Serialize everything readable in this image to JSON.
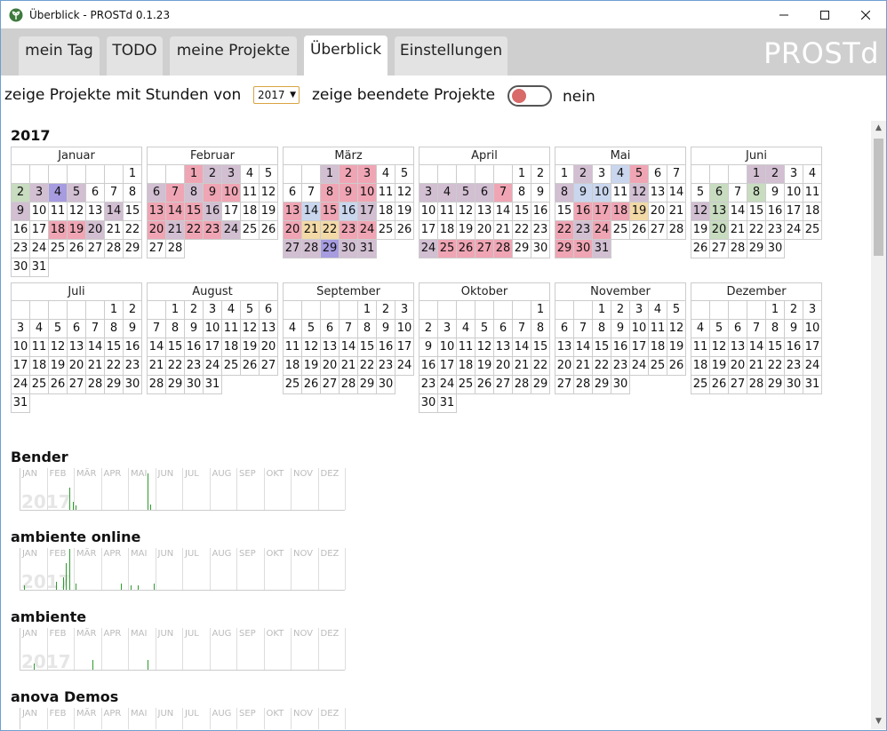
{
  "window": {
    "title": "Überblick - PROSTd 0.1.23",
    "minimize_icon": "minimize-icon",
    "maximize_icon": "maximize-icon",
    "close_icon": "close-icon"
  },
  "tabs": [
    {
      "label": "mein Tag",
      "active": false
    },
    {
      "label": "TODO",
      "active": false
    },
    {
      "label": "meine Projekte",
      "active": false
    },
    {
      "label": "Überblick",
      "active": true
    },
    {
      "label": "Einstellungen",
      "active": false
    }
  ],
  "brand": "PROSTd",
  "filter": {
    "label_hours": "zeige Projekte mit Stunden von",
    "year_value": "2017",
    "label_finished": "zeige beendete Projekte",
    "toggle_state": "nein"
  },
  "calendar": {
    "year": "2017",
    "months": [
      {
        "name": "Januar",
        "offset": 6,
        "days": 31
      },
      {
        "name": "Februar",
        "offset": 2,
        "days": 28
      },
      {
        "name": "März",
        "offset": 2,
        "days": 31
      },
      {
        "name": "April",
        "offset": 5,
        "days": 30
      },
      {
        "name": "Mai",
        "offset": 0,
        "days": 31
      },
      {
        "name": "Juni",
        "offset": 3,
        "days": 30
      },
      {
        "name": "Juli",
        "offset": 5,
        "days": 31
      },
      {
        "name": "August",
        "offset": 1,
        "days": 31
      },
      {
        "name": "September",
        "offset": 4,
        "days": 30
      },
      {
        "name": "Oktober",
        "offset": 6,
        "days": 31
      },
      {
        "name": "November",
        "offset": 2,
        "days": 30
      },
      {
        "name": "Dezember",
        "offset": 4,
        "days": 31
      }
    ],
    "highlights": {
      "Januar": {
        "2": "#c8dcc0",
        "3": "#d2bfd2",
        "4": "#a79ce0",
        "5": "#d2bfd2",
        "9": "#d2bfd2",
        "14": "#d2bfd2",
        "18": "#f0a5b4",
        "19": "#f0a5b4",
        "20": "#d2bfd2"
      },
      "Februar": {
        "1": "#f0a5b4",
        "2": "#d2bfd2",
        "3": "#d2bfd2",
        "6": "#d2bfd2",
        "7": "#f0a5b4",
        "8": "#d2bfd2",
        "9": "#f0a5b4",
        "10": "#f0a5b4",
        "13": "#f0a5b4",
        "14": "#f0a5b4",
        "15": "#f0a5b4",
        "16": "#d2bfd2",
        "20": "#f0a5b4",
        "21": "#d2bfd2",
        "22": "#f0a5b4",
        "23": "#f0a5b4",
        "24": "#d2bfd2"
      },
      "März": {
        "1": "#d2bfd2",
        "2": "#f0a5b4",
        "3": "#f0a5b4",
        "8": "#f0a5b4",
        "9": "#f0a5b4",
        "10": "#f0a5b4",
        "13": "#f0a5b4",
        "14": "#c9d6ee",
        "15": "#f0a5b4",
        "16": "#c9d6ee",
        "17": "#d2bfd2",
        "20": "#f0a5b4",
        "21": "#f2d9a6",
        "22": "#f2d9a6",
        "23": "#f0a5b4",
        "24": "#f0a5b4",
        "27": "#d2bfd2",
        "28": "#d2bfd2",
        "29": "#a79ce0",
        "30": "#d2bfd2",
        "31": "#d2bfd2"
      },
      "April": {
        "3": "#d2bfd2",
        "4": "#d2bfd2",
        "5": "#d2bfd2",
        "6": "#d2bfd2",
        "7": "#f0a5b4",
        "24": "#d2bfd2",
        "25": "#f0a5b4",
        "26": "#f0a5b4",
        "27": "#f0a5b4",
        "28": "#f0a5b4"
      },
      "Mai": {
        "2": "#d2bfd2",
        "4": "#c9d6ee",
        "5": "#f0a5b4",
        "8": "#d2bfd2",
        "9": "#c9d6ee",
        "10": "#c9d6ee",
        "12": "#d2bfd2",
        "16": "#f0a5b4",
        "17": "#f0a5b4",
        "18": "#f0a5b4",
        "19": "#f2d9a6",
        "22": "#f0a5b4",
        "23": "#d2bfd2",
        "24": "#f0a5b4",
        "29": "#f0a5b4",
        "30": "#f0a5b4",
        "31": "#d2bfd2"
      },
      "Juni": {
        "1": "#d2bfd2",
        "2": "#d2bfd2",
        "6": "#c8dcc0",
        "8": "#c8dcc0",
        "12": "#d2bfd2",
        "13": "#c8dcc0",
        "20": "#c8dcc0"
      }
    }
  },
  "spark_months": [
    "JAN",
    "FEB",
    "MÄR",
    "APR",
    "MAI",
    "JUN",
    "JUL",
    "AUG",
    "SEP",
    "OKT",
    "NOV",
    "DEZ"
  ],
  "projects": [
    {
      "name": "Bender",
      "year": "2017",
      "bars": [
        {
          "pos": 0.15,
          "h": 0.55
        },
        {
          "pos": 0.16,
          "h": 0.2
        },
        {
          "pos": 0.17,
          "h": 0.1
        },
        {
          "pos": 0.39,
          "h": 0.9
        },
        {
          "pos": 0.4,
          "h": 0.12
        }
      ]
    },
    {
      "name": "ambiente online",
      "year": "2017",
      "bars": [
        {
          "pos": 0.01,
          "h": 0.1
        },
        {
          "pos": 0.11,
          "h": 0.2
        },
        {
          "pos": 0.13,
          "h": 0.3
        },
        {
          "pos": 0.14,
          "h": 0.65
        },
        {
          "pos": 0.15,
          "h": 1.0
        },
        {
          "pos": 0.17,
          "h": 0.15
        },
        {
          "pos": 0.31,
          "h": 0.15
        },
        {
          "pos": 0.34,
          "h": 0.1
        },
        {
          "pos": 0.36,
          "h": 0.1
        },
        {
          "pos": 0.41,
          "h": 0.15
        }
      ]
    },
    {
      "name": "ambiente",
      "year": "2017",
      "bars": [
        {
          "pos": 0.04,
          "h": 0.15
        },
        {
          "pos": 0.22,
          "h": 0.25
        },
        {
          "pos": 0.39,
          "h": 0.25
        }
      ]
    },
    {
      "name": "anova Demos",
      "year": "2017",
      "bars": []
    }
  ],
  "colors": {
    "accent_border": "#6d9fd1",
    "toggle_knob": "#d86a6a",
    "spark_bar": "#2e9c2e"
  }
}
